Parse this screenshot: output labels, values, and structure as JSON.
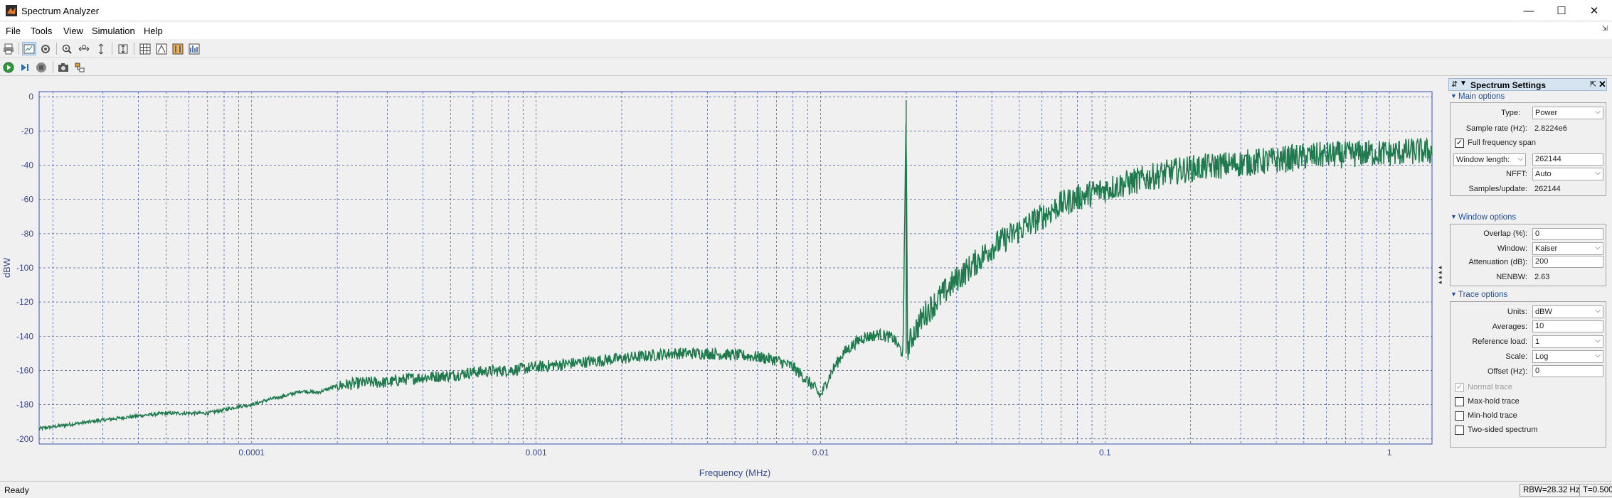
{
  "window": {
    "title": "Spectrum Analyzer",
    "controls": [
      "—",
      "☐",
      "✕"
    ]
  },
  "menu": [
    {
      "label": "File",
      "mnemonic": "F"
    },
    {
      "label": "Tools",
      "mnemonic": "T"
    },
    {
      "label": "View",
      "mnemonic": "V"
    },
    {
      "label": "Simulation",
      "mnemonic": "S"
    },
    {
      "label": "Help",
      "mnemonic": "H"
    }
  ],
  "toolbar_icons": [
    "print-icon",
    "spectrum-view-icon",
    "settings-icon",
    "zoom-in-icon",
    "zoom-x-icon",
    "zoom-y-icon",
    "scale-axes-icon",
    "grid-icon",
    "peak-finder-icon",
    "cursor-measurements-icon",
    "channel-measurements-icon"
  ],
  "sim_toolbar_icons": [
    "run-icon",
    "step-forward-icon",
    "stop-icon",
    "snapshot-icon",
    "highlight-block-icon"
  ],
  "plot": {
    "line_color": "#1f7a4d",
    "grid_color": "#3a4fb0",
    "axis_text_color": "#3a4a8f"
  },
  "chart_data": {
    "type": "line",
    "xlabel": "Frequency (MHz)",
    "ylabel": "dBW",
    "x_scale": "log",
    "xlim": [
      1.79e-05,
      1.4112
    ],
    "ylim": [
      -203,
      3
    ],
    "x_ticks": [
      {
        "value": 0.0001,
        "label": "0.0001"
      },
      {
        "value": 0.001,
        "label": "0.001"
      },
      {
        "value": 0.01,
        "label": "0.01"
      },
      {
        "value": 0.1,
        "label": "0.1"
      },
      {
        "value": 1,
        "label": "1"
      }
    ],
    "y_ticks": [
      0,
      -20,
      -40,
      -60,
      -80,
      -100,
      -120,
      -140,
      -160,
      -180,
      -200
    ],
    "grid": true,
    "series": [
      {
        "color": "#1f7a4d",
        "points": [
          [
            1.79e-05,
            -194
          ],
          [
            3e-05,
            -189
          ],
          [
            4e-05,
            -186.5
          ],
          [
            5e-05,
            -185
          ],
          [
            6e-05,
            -185
          ],
          [
            7e-05,
            -185
          ],
          [
            8e-05,
            -183
          ],
          [
            9e-05,
            -181
          ],
          [
            0.0001,
            -180
          ],
          [
            0.000115,
            -177
          ],
          [
            0.00013,
            -175
          ],
          [
            0.00015,
            -172
          ],
          [
            0.00017,
            -173
          ],
          [
            0.0002,
            -169
          ],
          [
            0.00025,
            -167
          ],
          [
            0.0003,
            -167
          ],
          [
            0.00035,
            -165
          ],
          [
            0.0004,
            -164
          ],
          [
            0.0005,
            -163
          ],
          [
            0.0006,
            -161
          ],
          [
            0.0008,
            -160
          ],
          [
            0.001,
            -158
          ],
          [
            0.0015,
            -155
          ],
          [
            0.002,
            -153
          ],
          [
            0.003,
            -150
          ],
          [
            0.004,
            -150
          ],
          [
            0.005,
            -151
          ],
          [
            0.006,
            -152
          ],
          [
            0.007,
            -154
          ],
          [
            0.008,
            -158
          ],
          [
            0.009,
            -166
          ],
          [
            0.0095,
            -170
          ],
          [
            0.01,
            -175
          ],
          [
            0.0105,
            -167
          ],
          [
            0.011,
            -160
          ],
          [
            0.012,
            -150
          ],
          [
            0.013,
            -145
          ],
          [
            0.014,
            -141
          ],
          [
            0.016,
            -139
          ],
          [
            0.018,
            -141
          ],
          [
            0.0195,
            -150
          ],
          [
            0.02,
            -2
          ],
          [
            0.0202,
            -148
          ],
          [
            0.021,
            -140
          ],
          [
            0.023,
            -128
          ],
          [
            0.027,
            -115
          ],
          [
            0.03,
            -107
          ],
          [
            0.035,
            -97
          ],
          [
            0.04,
            -88
          ],
          [
            0.05,
            -78
          ],
          [
            0.06,
            -70
          ],
          [
            0.07,
            -63
          ],
          [
            0.08,
            -59
          ],
          [
            0.1,
            -54
          ],
          [
            0.13,
            -49
          ],
          [
            0.17,
            -44
          ],
          [
            0.2,
            -42
          ],
          [
            0.3,
            -39
          ],
          [
            0.4,
            -37
          ],
          [
            0.5,
            -35
          ],
          [
            0.6,
            -34
          ],
          [
            0.7,
            -34
          ],
          [
            0.8,
            -33
          ],
          [
            1.0,
            -33
          ],
          [
            1.2,
            -32
          ],
          [
            1.4112,
            -32
          ]
        ],
        "noise_envelope_db": 8
      }
    ]
  },
  "settings": {
    "title": "Spectrum Settings",
    "main": {
      "section_title": "Main options",
      "type_label": "Type:",
      "type_value": "Power",
      "sample_rate_label": "Sample rate (Hz):",
      "sample_rate_value": "2.8224e6",
      "full_span_label": "Full frequency span",
      "full_span_checked": true,
      "window_length_select": "Window length:",
      "window_length_value": "262144",
      "nfft_label": "NFFT:",
      "nfft_value": "Auto",
      "samples_label": "Samples/update:",
      "samples_value": "262144"
    },
    "window": {
      "section_title": "Window options",
      "overlap_label": "Overlap (%):",
      "overlap_value": "0",
      "window_label": "Window:",
      "window_value": "Kaiser",
      "attenuation_label": "Attenuation (dB):",
      "attenuation_value": "200",
      "nenbw_label": "NENBW:",
      "nenbw_value": "2.63"
    },
    "trace": {
      "section_title": "Trace options",
      "units_label": "Units:",
      "units_value": "dBW",
      "averages_label": "Averages:",
      "averages_value": "10",
      "refload_label": "Reference load:",
      "refload_value": "1",
      "scale_label": "Scale:",
      "scale_value": "Log",
      "offset_label": "Offset (Hz):",
      "offset_value": "0",
      "normal_trace": "Normal trace",
      "maxhold_trace": "Max-hold trace",
      "minhold_trace": "Min-hold trace",
      "twosided": "Two-sided spectrum"
    }
  },
  "status": {
    "text": "Ready",
    "rbw": "RBW=28.32 Hz",
    "time": "T=0.500"
  }
}
